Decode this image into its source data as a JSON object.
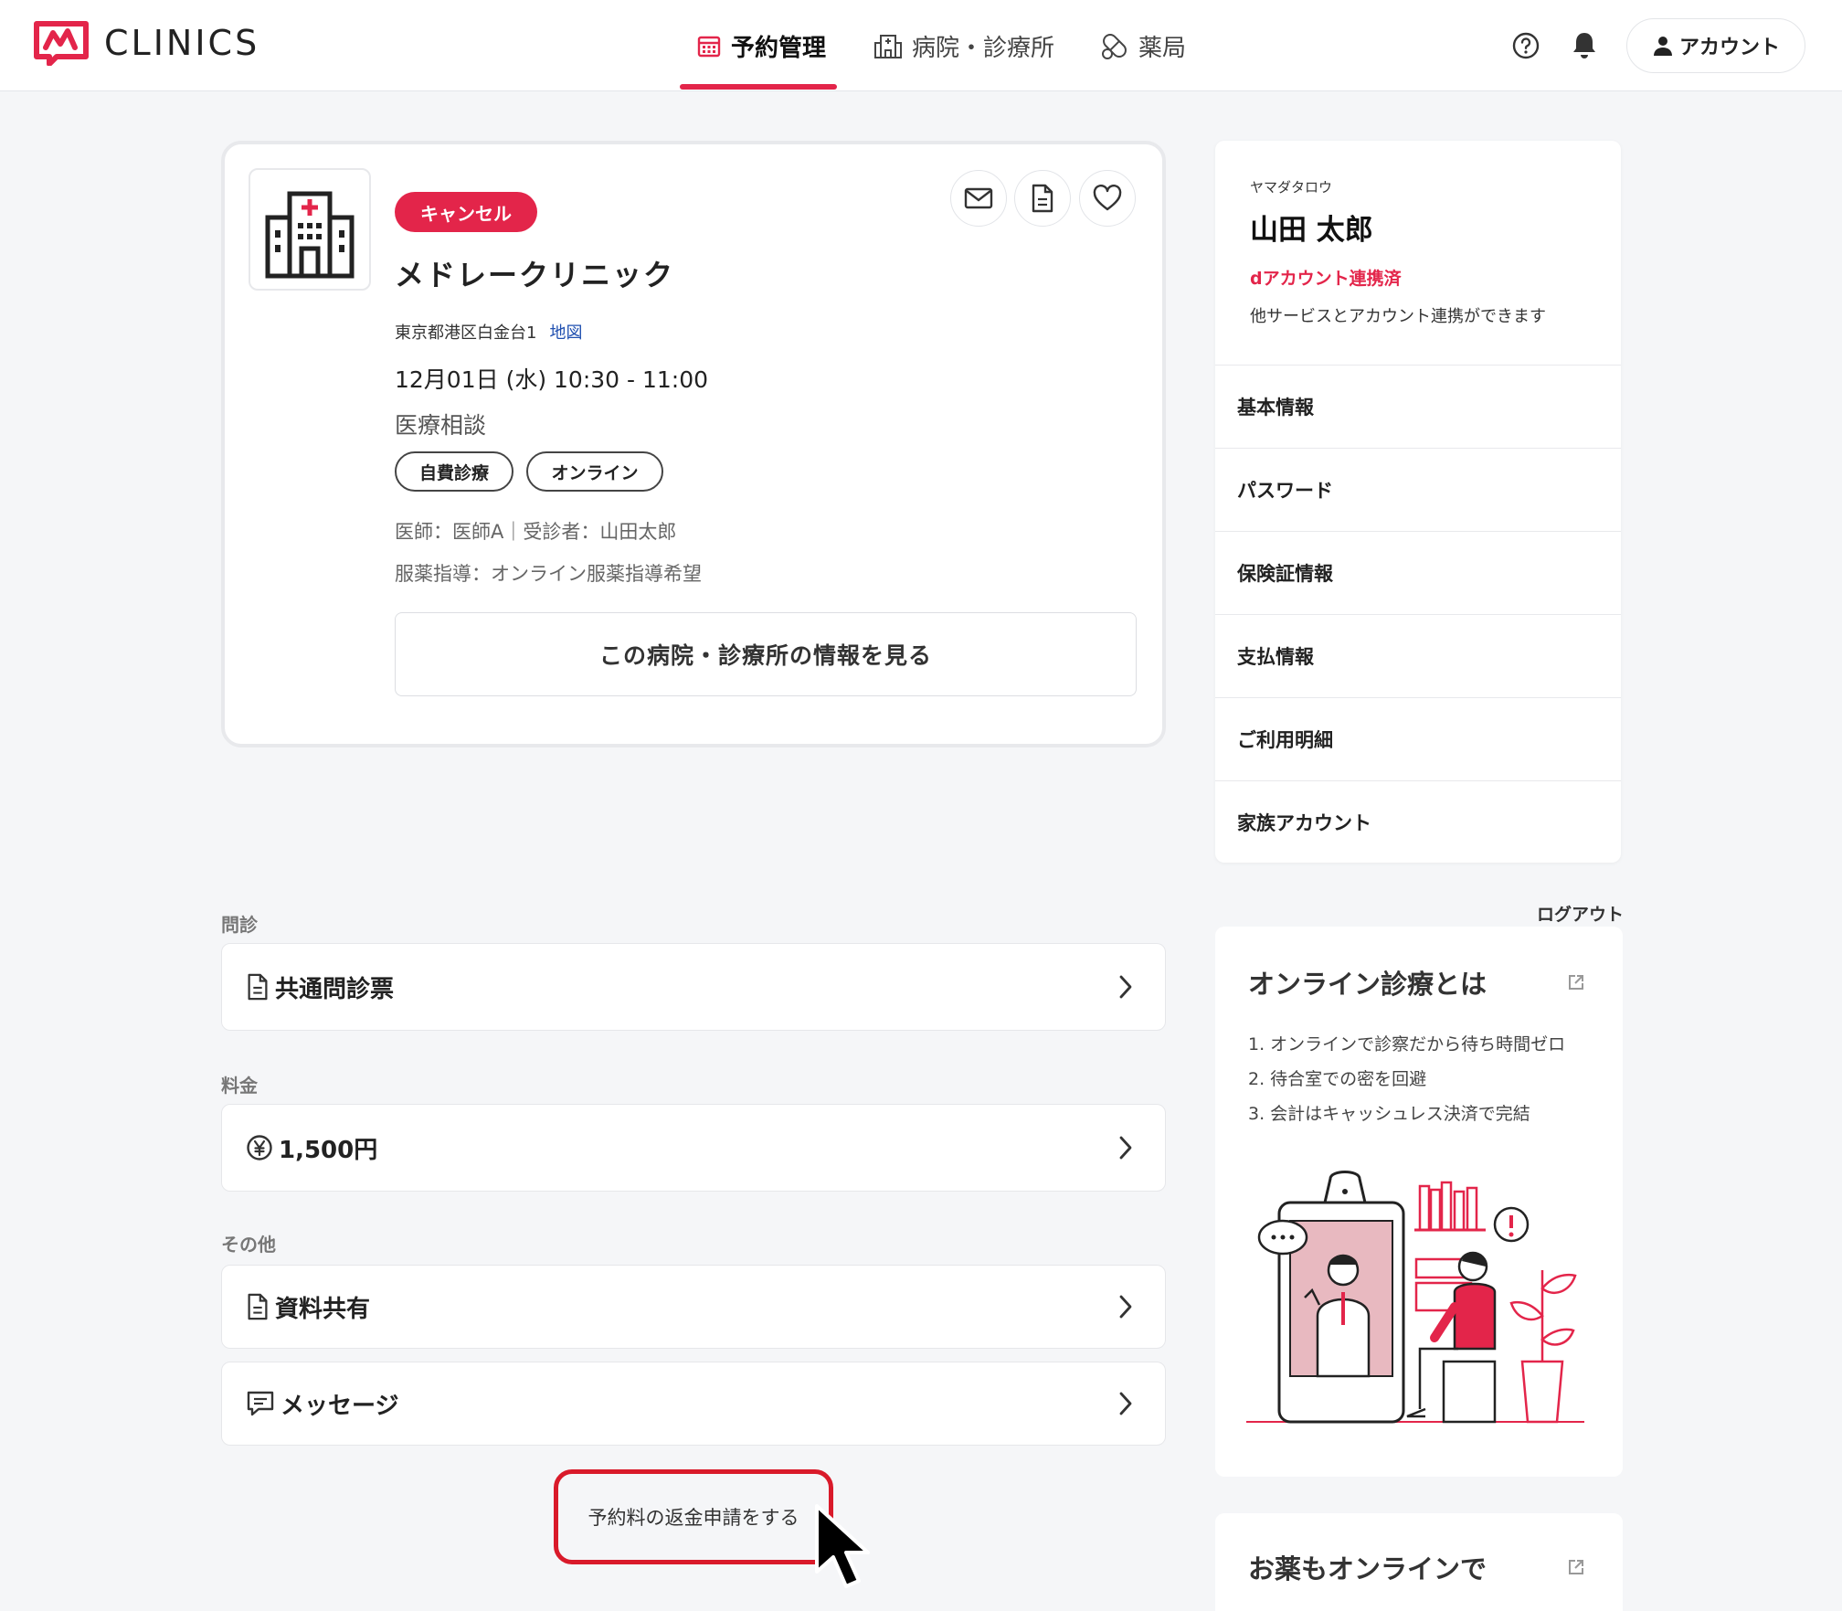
{
  "header": {
    "logo_text": "CLINICS",
    "nav": [
      {
        "label": "予約管理",
        "active": true
      },
      {
        "label": "病院・診療所",
        "active": false
      },
      {
        "label": "薬局",
        "active": false
      }
    ],
    "account_label": "アカウント"
  },
  "reservation": {
    "status_badge": "キャンセル",
    "clinic_name": "メドレークリニック",
    "address": "東京都港区白金台1",
    "map_link": "地図",
    "datetime": "12月01日 (水) 10:30 - 11:00",
    "consult_type": "医療相談",
    "tags": [
      "自費診療",
      "オンライン"
    ],
    "doctor_line": "医師：医師A｜受診者：山田太郎",
    "pharmacy_line": "服薬指導：オンライン服薬指導希望",
    "view_button": "この病院・診療所の情報を見る"
  },
  "profile": {
    "kana": "ヤマダタロウ",
    "name": "山田 太郎",
    "d_account_link": "dアカウント連携済",
    "d_account_desc": "他サービスとアカウント連携ができます",
    "menu": [
      "基本情報",
      "パスワード",
      "保険証情報",
      "支払情報",
      "ご利用明細",
      "家族アカウント"
    ],
    "logout": "ログアウト"
  },
  "sections": {
    "questionnaire_label": "問診",
    "questionnaire_item": "共通問診票",
    "fee_label": "料金",
    "fee_item": "1,500円",
    "other_label": "その他",
    "other_items": [
      "資料共有",
      "メッセージ"
    ]
  },
  "refund_link": "予約料の返金申請をする",
  "online_card": {
    "title": "オンライン診療とは",
    "points": [
      "1. オンラインで診察だから待ち時間ゼロ",
      "2. 待合室での密を回避",
      "3. 会計はキャッシュレス決済で完結"
    ]
  },
  "online_card2": {
    "title": "お薬もオンラインで"
  },
  "colors": {
    "accent": "#e3254a",
    "link": "#1f4fb0",
    "refund_outline": "#d91a2a"
  }
}
